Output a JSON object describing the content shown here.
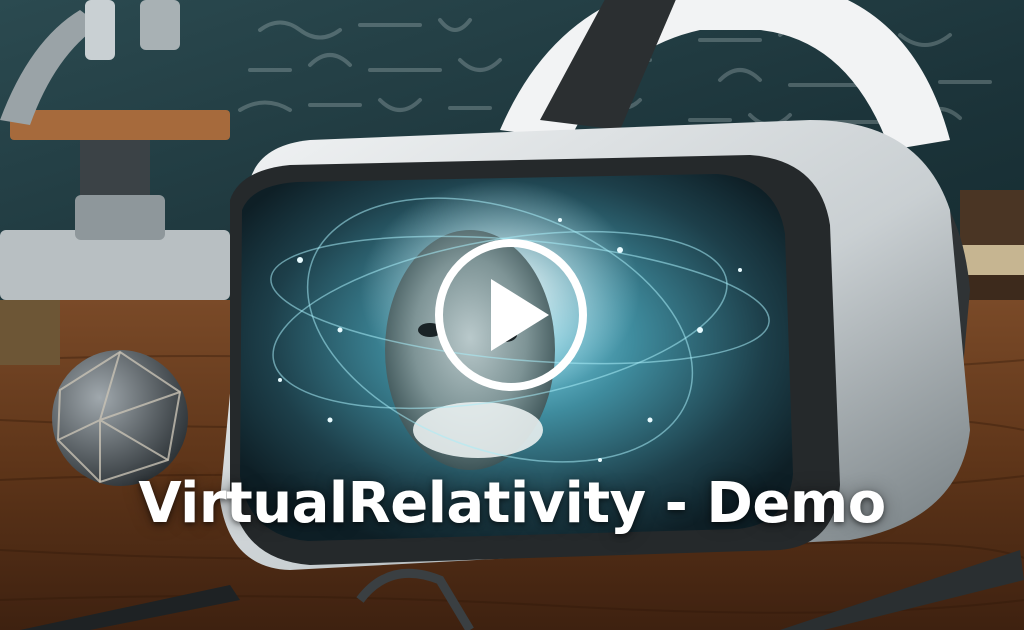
{
  "video": {
    "title": "VirtualRelativity - Demo",
    "play_icon": "play-icon",
    "thumbnail_subject": "vr-headset-einstein-icon"
  },
  "colors": {
    "title_text": "#ffffff",
    "play_button": "#ffffff",
    "chalkboard": "#1f3a40",
    "wood_desk": "#6b4024",
    "visor_glow": "#6fd4ec"
  }
}
